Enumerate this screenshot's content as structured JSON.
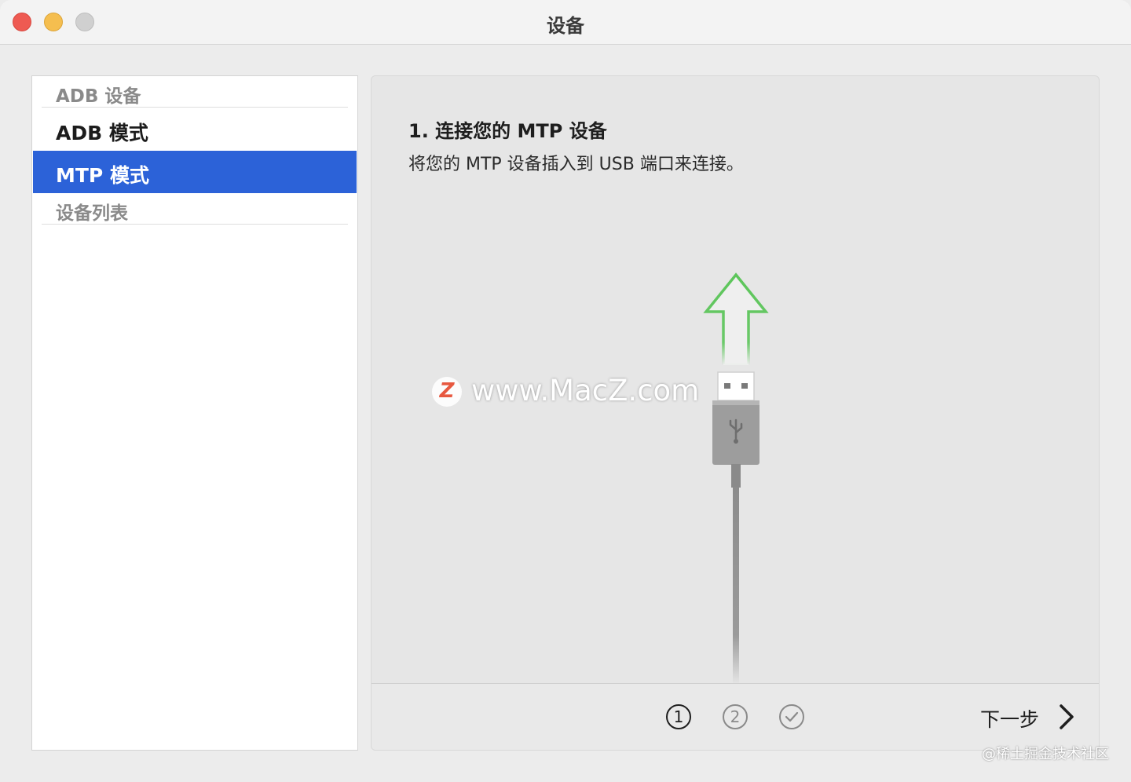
{
  "window": {
    "title": "设备"
  },
  "sidebar": {
    "groups": [
      {
        "label": "ADB 设备"
      },
      {
        "label": "设备列表"
      }
    ],
    "items": [
      {
        "label": "ADB 模式",
        "selected": false
      },
      {
        "label": "MTP 模式",
        "selected": true
      }
    ]
  },
  "main": {
    "step_title": "1. 连接您的 MTP 设备",
    "step_description": "将您的 MTP 设备插入到 USB 端口来连接。",
    "illustration": {
      "arrow_icon": "up-arrow-icon",
      "arrow_color": "#5cc55a",
      "plug_icon": "usb-plug-icon"
    },
    "steps": [
      {
        "label": "1",
        "state": "current"
      },
      {
        "label": "2",
        "state": "pending"
      },
      {
        "label": "✓",
        "state": "pending"
      }
    ],
    "next_button": {
      "label": "下一步"
    }
  },
  "overlays": {
    "watermark_logo": "Z",
    "watermark_text": "www.MacZ.com",
    "credit": "@稀土掘金技术社区"
  },
  "colors": {
    "accent": "#2c62d8",
    "close": "#ee5a52",
    "minimize": "#f5be4f"
  }
}
